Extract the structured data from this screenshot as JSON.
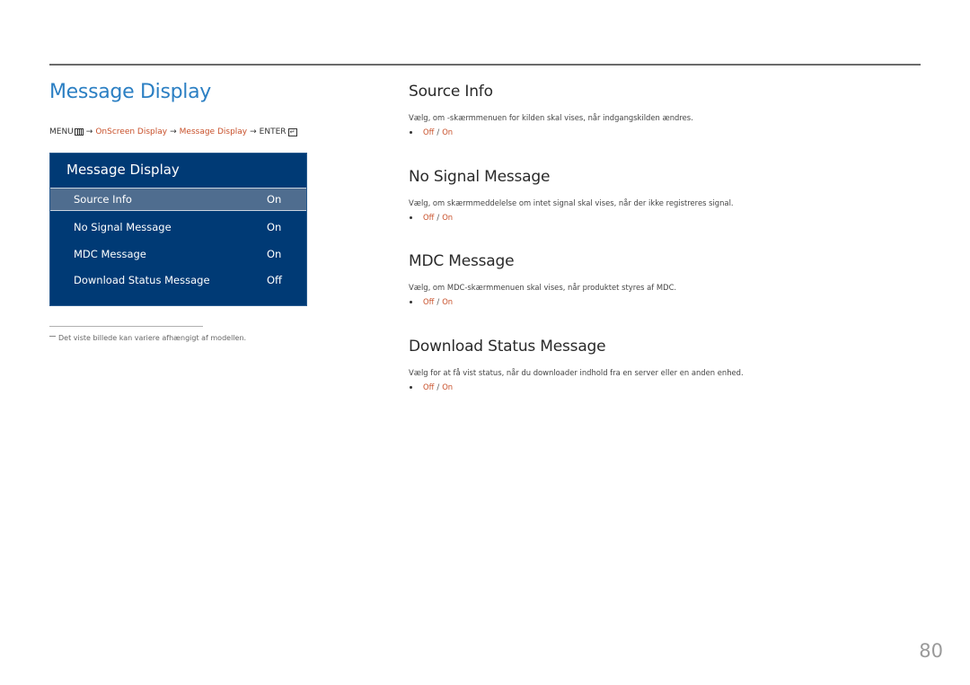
{
  "page": {
    "title": "Message Display",
    "page_number": "80"
  },
  "breadcrumb": {
    "menu": "MENU",
    "menu_icon": "menu-icon",
    "path": [
      "OnScreen Display",
      "Message Display"
    ],
    "enter": "ENTER",
    "enter_icon": "enter-icon",
    "arrow": "→"
  },
  "osd_menu": {
    "title": "Message Display",
    "items": [
      {
        "label": "Source Info",
        "value": "On",
        "selected": true
      },
      {
        "label": "No Signal Message",
        "value": "On",
        "selected": false
      },
      {
        "label": "MDC Message",
        "value": "On",
        "selected": false
      },
      {
        "label": "Download Status Message",
        "value": "Off",
        "selected": false
      }
    ]
  },
  "footnote": "Det viste billede kan variere afhængigt af modellen.",
  "sections": [
    {
      "heading": "Source Info",
      "description": "Vælg, om -skærmmenuen for kilden skal vises, når indgangskilden ændres.",
      "options": [
        "Off",
        "On"
      ],
      "separator": "/"
    },
    {
      "heading": "No Signal Message",
      "description": "Vælg, om skærmmeddelelse om intet signal skal vises, når der ikke registreres signal.",
      "options": [
        "Off",
        "On"
      ],
      "separator": "/"
    },
    {
      "heading": "MDC Message",
      "description": "Vælg, om MDC-skærmmenuen skal vises, når produktet styres af MDC.",
      "options": [
        "Off",
        "On"
      ],
      "separator": "/"
    },
    {
      "heading": "Download Status Message",
      "description": "Vælg for at få vist status, når du downloader indhold fra en server eller en anden enhed.",
      "options": [
        "Off",
        "On"
      ],
      "separator": "/"
    }
  ],
  "colors": {
    "title_blue": "#2b7fc3",
    "link_orange": "#c8502a",
    "osd_background": "#003a75",
    "osd_selected": "#4f6d8f"
  }
}
